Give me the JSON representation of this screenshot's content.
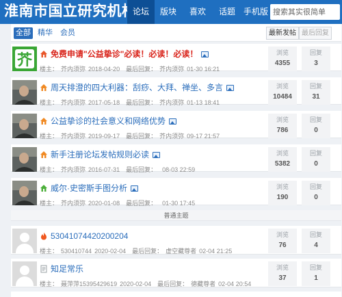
{
  "header": {
    "site_title": "淮南市国立研究机构",
    "nav": [
      {
        "label": "论坛",
        "active": true
      },
      {
        "label": "版块",
        "active": false
      },
      {
        "label": "喜欢",
        "active": false
      },
      {
        "label": "话题",
        "active": false
      },
      {
        "label": "手机版",
        "active": false
      }
    ],
    "search_placeholder": "搜索其实很简单"
  },
  "filters": {
    "tabs": [
      {
        "label": "全部",
        "active": true
      },
      {
        "label": "精华",
        "active": false
      },
      {
        "label": "会员",
        "active": false
      }
    ],
    "sort": [
      {
        "label": "最新发帖",
        "active": true
      },
      {
        "label": "最后回复",
        "active": false
      }
    ]
  },
  "stat_labels": {
    "views": "浏览",
    "replies": "回复"
  },
  "threads": [
    {
      "icon": "home-icon-red",
      "title": "免费申请\"公益挚诊\"必读！必读！必读！",
      "highlight": true,
      "has_image": true,
      "author_label": "楼主：",
      "author": "芥内须弥",
      "date": "2018-04-20",
      "last_label": "最后回复：",
      "last_by": "芥内须弥",
      "last_time": "01-30 16:21",
      "views": "4355",
      "replies": "3",
      "avatar": "green-logo"
    },
    {
      "icon": "home-icon-orange",
      "title": "周天排澄的四大利器：刮痧、大拜、禅坐、多言",
      "highlight": false,
      "has_image": true,
      "author_label": "楼主：",
      "author": "芥内须弥",
      "date": "2017-05-18",
      "last_label": "最后回复：",
      "last_by": "芥内须弥",
      "last_time": "01-13 18:41",
      "views": "10484",
      "replies": "31",
      "avatar": "portrait"
    },
    {
      "icon": "home-icon-orange",
      "title": "公益挚诊的社会意义和网络优势",
      "highlight": false,
      "has_image": true,
      "author_label": "楼主：",
      "author": "芥内须弥",
      "date": "2019-09-17",
      "last_label": "最后回复：",
      "last_by": "芥内须弥",
      "last_time": "09-17 21:57",
      "views": "786",
      "replies": "0",
      "avatar": "portrait"
    },
    {
      "icon": "home-icon-orange",
      "title": "新手注册论坛发帖规则必读",
      "highlight": false,
      "has_image": true,
      "author_label": "楼主：",
      "author": "芥内须弥",
      "date": "2016-07-31",
      "last_label": "最后回复：",
      "last_by": "",
      "last_time": "08-03 22:59",
      "views": "5382",
      "replies": "0",
      "avatar": "portrait"
    },
    {
      "icon": "home-icon-green",
      "title": "威尔·史密斯手图分析",
      "highlight": false,
      "has_image": true,
      "author_label": "楼主：",
      "author": "芥内须弥",
      "date": "2020-01-08",
      "last_label": "最后回复：",
      "last_by": "",
      "last_time": "01-30 17:45",
      "views": "190",
      "replies": "0",
      "avatar": "portrait"
    }
  ],
  "separator_label": "普通主题",
  "normal_threads": [
    {
      "icon": "fire-icon",
      "title": "53041074420200204",
      "has_image": false,
      "author_label": "楼主：",
      "author": "530410744",
      "date": "2020-02-04",
      "last_label": "最后回复：",
      "last_by": "虚空藏尊者",
      "last_time": "02-04 21:25",
      "views": "76",
      "replies": "4"
    },
    {
      "icon": "doc-icon",
      "title": "知足常乐",
      "has_image": false,
      "author_label": "楼主：",
      "author": "聂萍萍15395429619",
      "date": "2020-02-04",
      "last_label": "最后回复：",
      "last_by": "德藏尊者",
      "last_time": "02-04 20:54",
      "views": "37",
      "replies": "1"
    }
  ],
  "colors": {
    "header_bg": "#1f6fc0",
    "link": "#2a6dbb",
    "highlight": "#d9251c"
  }
}
